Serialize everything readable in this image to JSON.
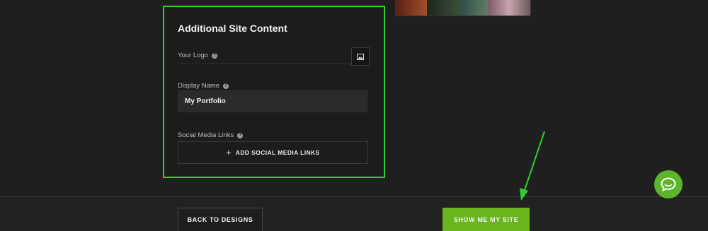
{
  "colors": {
    "accent_green": "#68b51d",
    "highlight_border": "#2fd12f",
    "chat_green": "#5cb52a",
    "background": "#1f1f1f"
  },
  "thumbnails": [
    {
      "color": "#6a2b1f"
    },
    {
      "color": "#2b3a2f"
    },
    {
      "color": "#3a5a4a"
    },
    {
      "color": "#8a6a7a"
    }
  ],
  "panel": {
    "title": "Additional Site Content",
    "logo": {
      "label": "Your Logo",
      "icon": "image-icon"
    },
    "display_name": {
      "label": "Display Name",
      "value": "My Portfolio"
    },
    "social": {
      "label": "Social Media Links",
      "button_label": "ADD SOCIAL MEDIA LINKS"
    },
    "help_icon": "question-circle-icon"
  },
  "footer": {
    "back_label": "BACK TO DESIGNS",
    "show_label": "SHOW ME MY SITE"
  },
  "chat": {
    "icon": "chat-bubble-icon"
  }
}
